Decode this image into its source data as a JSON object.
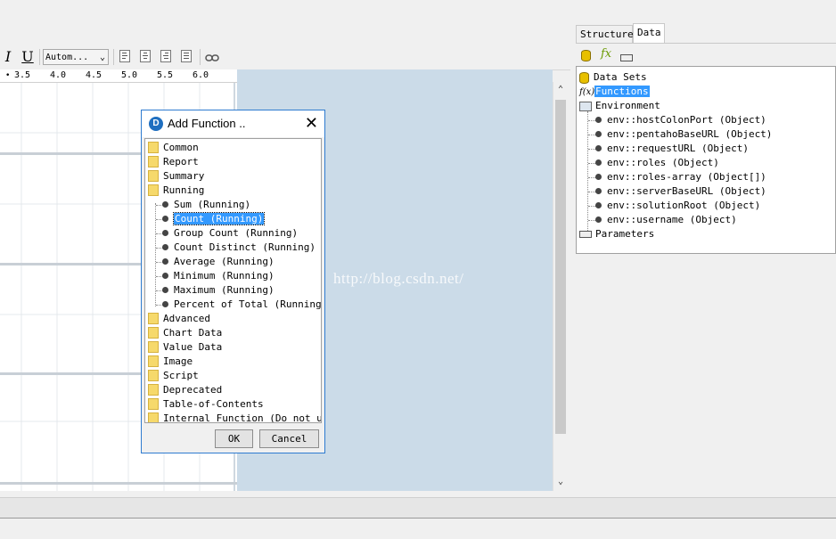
{
  "toolbar": {
    "italic_label": "I",
    "underline_label": "U",
    "font_select_value": "Autom...",
    "link_icon": "link-icon"
  },
  "ruler": {
    "ticks": [
      "3.5",
      "4.0",
      "4.5",
      "5.0",
      "5.5",
      "6.0"
    ]
  },
  "watermark": "http://blog.csdn.net/",
  "right_panel": {
    "tabs": [
      {
        "label": "Structure"
      },
      {
        "label": "Data"
      }
    ],
    "active_tab": "Data",
    "toolbar_icons": [
      "add-dataset-icon",
      "add-function-icon",
      "add-parameter-icon"
    ],
    "tree": {
      "data_sets": "Data Sets",
      "functions": "Functions",
      "environment": "Environment",
      "env_items": [
        "env::hostColonPort (Object)",
        "env::pentahoBaseURL (Object)",
        "env::requestURL (Object)",
        "env::roles (Object)",
        "env::roles-array (Object[])",
        "env::serverBaseURL (Object)",
        "env::solutionRoot (Object)",
        "env::username (Object)"
      ],
      "parameters": "Parameters"
    }
  },
  "dialog": {
    "title": "Add Function ..",
    "categories_before": [
      "Common",
      "Report",
      "Summary",
      "Running"
    ],
    "running_items": [
      "Sum (Running)",
      "Count (Running)",
      "Group Count (Running)",
      "Count Distinct (Running)",
      "Average (Running)",
      "Minimum (Running)",
      "Maximum (Running)",
      "Percent of Total (Running)"
    ],
    "selected_item": "Count (Running)",
    "categories_after": [
      "Advanced",
      "Chart Data",
      "Value Data",
      "Image",
      "Script",
      "Deprecated",
      "Table-of-Contents",
      "Internal Function (Do not use)"
    ],
    "ok_label": "OK",
    "cancel_label": "Cancel"
  }
}
